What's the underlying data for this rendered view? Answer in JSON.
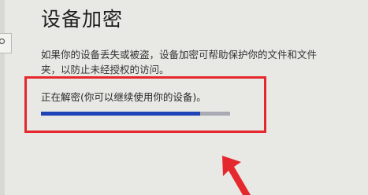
{
  "header": {
    "title": "设备加密"
  },
  "main": {
    "description": "如果你的设备丢失或被盗，设备加密可帮助保护你的文件和文件夹，以防止未经授权的访问。",
    "status_text": "正在解密(你可以继续使用你的设备)。",
    "progress_fraction": 0.84
  },
  "annotation": {
    "color": "#e5282d"
  },
  "icons": {
    "search": "search-icon"
  }
}
